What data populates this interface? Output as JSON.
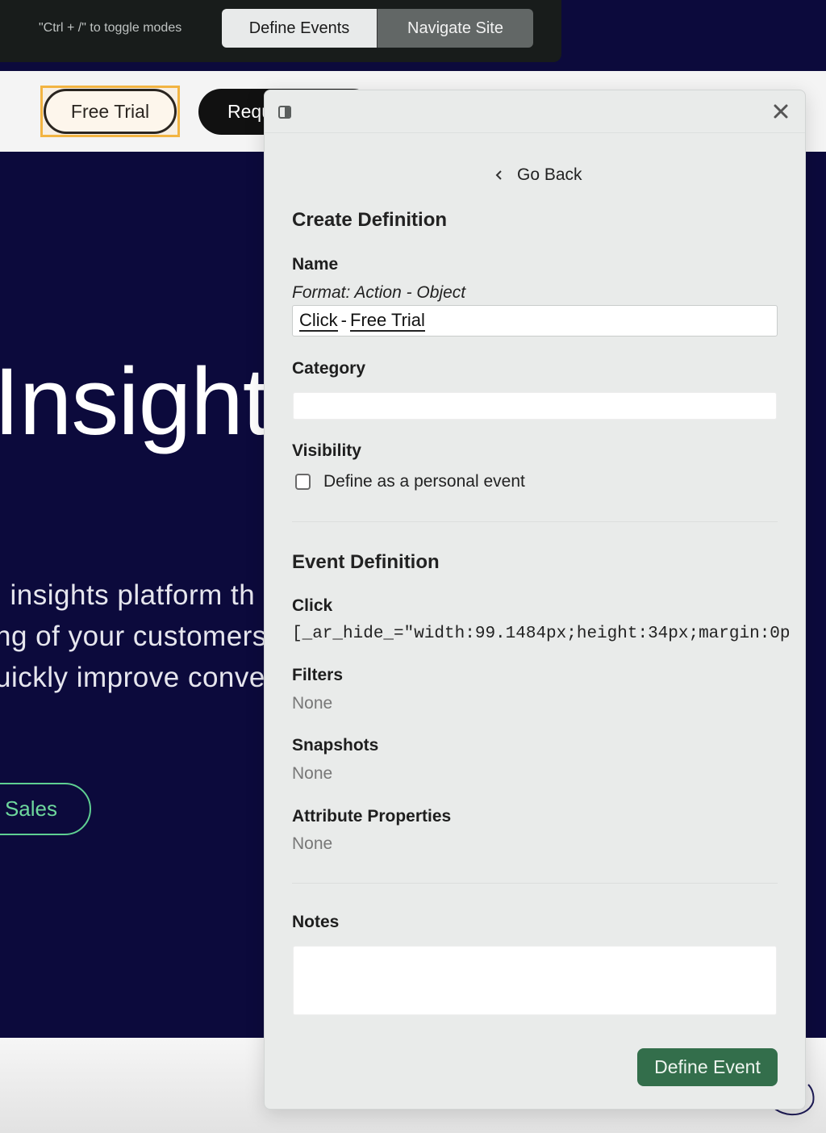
{
  "mode_bar": {
    "hint": "\"Ctrl + /\" to toggle modes",
    "modes": [
      {
        "label": "Define Events",
        "active": true
      },
      {
        "label": "Navigate Site",
        "active": false
      }
    ]
  },
  "site": {
    "free_trial_label": "Free Trial",
    "request_label": "Request",
    "hero_title": "Insight",
    "hero_lines": [
      "l insights platform th",
      "ng of your customers",
      "uickly improve conve"
    ],
    "sales_label": ": Sales",
    "colors": {
      "hero_bg": "#0c0a3c",
      "highlight": "#f2b442",
      "sales_accent": "#5fcf92"
    }
  },
  "panel": {
    "icons": {
      "dock": "dock-side-icon",
      "close": "close-icon"
    },
    "go_back": "Go Back",
    "title": "Create Definition",
    "name": {
      "label": "Name",
      "hint": "Format: Action - Object",
      "tokens": [
        "Click",
        "-",
        "Free Trial"
      ]
    },
    "category": {
      "label": "Category",
      "value": ""
    },
    "visibility": {
      "label": "Visibility",
      "checkbox_label": "Define as a personal event",
      "checked": false
    },
    "event_definition": {
      "title": "Event Definition",
      "click_label": "Click",
      "selector": "[_ar_hide_=\"width:99.1484px;height:34px;margin:0p",
      "filters_label": "Filters",
      "filters_value": "None",
      "snapshots_label": "Snapshots",
      "snapshots_value": "None",
      "attributes_label": "Attribute Properties",
      "attributes_value": "None"
    },
    "notes": {
      "label": "Notes",
      "value": ""
    },
    "submit_label": "Define Event",
    "colors": {
      "submit_bg": "#336e4b"
    }
  }
}
